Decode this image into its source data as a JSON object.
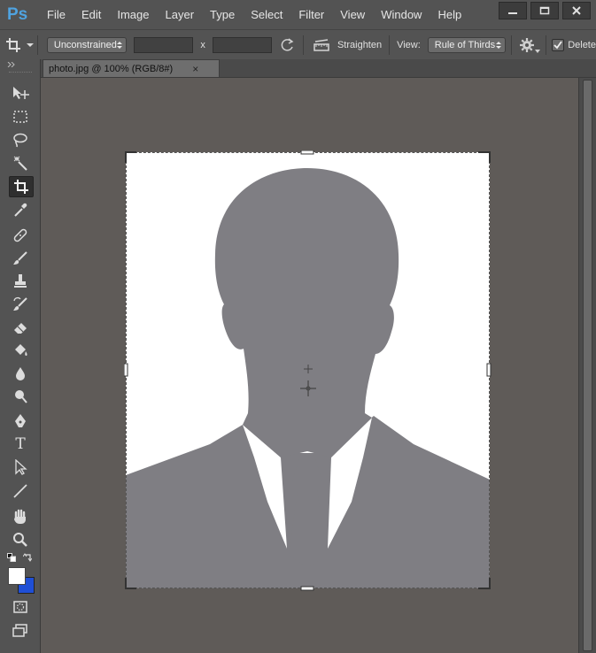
{
  "app": {
    "logo": "Ps"
  },
  "menu": [
    "File",
    "Edit",
    "Image",
    "Layer",
    "Type",
    "Select",
    "Filter",
    "View",
    "Window",
    "Help"
  ],
  "window_controls": [
    "minimize-icon",
    "maximize-icon",
    "close-icon"
  ],
  "options": {
    "ratio_value": "Unconstrained",
    "width_value": "",
    "separator": "x",
    "height_value": "",
    "straighten_label": "Straighten",
    "view_label": "View:",
    "view_value": "Rule of Thirds",
    "delete_label": "Delete",
    "delete_checked": true
  },
  "document": {
    "tab_title": "photo.jpg @ 100% (RGB/8#)",
    "close_symbol": "×"
  },
  "tools": [
    "move-tool",
    "marquee-tool",
    "lasso-tool",
    "magic-wand-tool",
    "crop-tool",
    "eyedropper-tool",
    "healing-brush-tool",
    "brush-tool",
    "clone-stamp-tool",
    "history-brush-tool",
    "eraser-tool",
    "paint-bucket-tool",
    "blur-tool",
    "dodge-tool",
    "pen-tool",
    "type-tool",
    "path-selection-tool",
    "line-tool",
    "hand-tool",
    "zoom-tool"
  ],
  "active_tool": "crop-tool",
  "type_tool_glyph": "T",
  "colors": {
    "foreground": "#ffffff",
    "background": "#1f4fd6",
    "silhouette": "#7f7e83",
    "pasteboard": "#5f5b58",
    "ui": "#535353"
  }
}
